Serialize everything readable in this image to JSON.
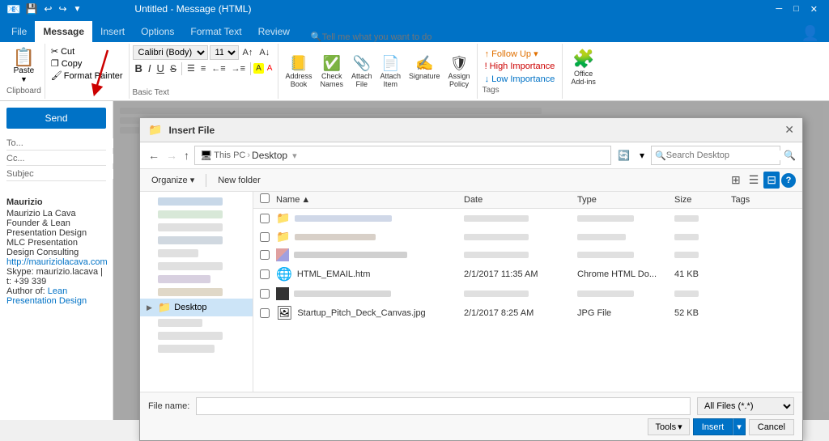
{
  "titlebar": {
    "title": "Untitled - Message (HTML)",
    "min": "─",
    "max": "□",
    "close": "✕"
  },
  "quickaccess": {
    "save": "💾",
    "undo": "↩",
    "redo": "↪"
  },
  "ribbon": {
    "tabs": [
      "File",
      "Message",
      "Insert",
      "Options",
      "Format Text",
      "Review"
    ],
    "active_tab": "Message",
    "tell_me": "Tell me what you want to do",
    "clipboard": {
      "label": "Clipboard",
      "paste": "Paste",
      "cut": "✂ Cut",
      "copy": "❐ Copy",
      "format_painter": "Format Painter"
    },
    "font": {
      "label": "Basic Text",
      "name": "Calibri (Body)",
      "size": "11",
      "bold": "B",
      "italic": "I",
      "underline": "U",
      "strikethrough": "S"
    },
    "include": {
      "address_book": "Address\nBook",
      "check_names": "Check\nNames",
      "attach_file": "Attach\nFile",
      "attach_item": "Attach\nItem",
      "signature": "Signature",
      "assign_policy": "Assign\nPolicy"
    },
    "tags": {
      "follow_up": "↑ Follow Up",
      "high_importance": "! High Importance",
      "low_importance": "↓ Low Importance"
    },
    "add_ins": {
      "label": "Office\nAdd-ins"
    }
  },
  "compose": {
    "to_label": "To...",
    "cc_label": "Cc...",
    "subject_label": "Subject",
    "send_label": "Send",
    "signature": {
      "name": "Maurizio",
      "full_name": "Maurizio La Cava",
      "title": "Founder & Lean Presentation Design",
      "company": "MLC Presentation Design Consulting",
      "url": "http://mauriziolacava.com",
      "skype": "Skype: maurizio.lacava | t: +39 339",
      "author": "Author of: Lean Presentation Design"
    }
  },
  "dialog": {
    "title": "Insert File",
    "close": "✕",
    "breadcrumb_pc": "This PC",
    "breadcrumb_sep": "›",
    "current_folder": "Desktop",
    "search_placeholder": "Search Desktop",
    "organize": "Organize ▾",
    "new_folder": "New folder",
    "columns": {
      "name": "Name",
      "date": "Date",
      "type": "Type",
      "size": "Size",
      "tags": "Tags"
    },
    "files": [
      {
        "name": "HTML_EMAIL.htm",
        "icon": "🌐",
        "date": "2/1/2017 11:35 AM",
        "type": "Chrome HTML Do...",
        "size": "41 KB",
        "tags": ""
      },
      {
        "name": "Startup_Pitch_Deck_Canvas.jpg",
        "icon": "🖼",
        "date": "2/1/2017 8:25 AM",
        "type": "JPG File",
        "size": "52 KB",
        "tags": ""
      }
    ],
    "filename_label": "File name:",
    "filetype_label": "All Files (*.*)",
    "tools_label": "Tools",
    "insert_label": "Insert",
    "cancel_label": "Cancel",
    "view_icons": [
      "⊞",
      "☰",
      "⚙"
    ]
  }
}
